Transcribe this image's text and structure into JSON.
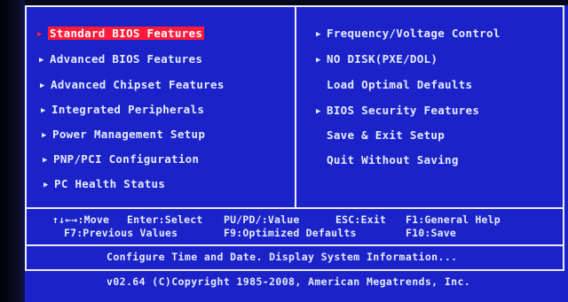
{
  "menu_left": [
    {
      "label": "Standard BIOS Features",
      "selected": true
    },
    {
      "label": "Advanced BIOS Features"
    },
    {
      "label": "Advanced Chipset Features"
    },
    {
      "label": "Integrated Peripherals"
    },
    {
      "label": "Power Management Setup"
    },
    {
      "label": "PNP/PCI Configuration"
    },
    {
      "label": "PC Health Status"
    }
  ],
  "menu_right": [
    {
      "label": "Frequency/Voltage Control",
      "arrow": true
    },
    {
      "label": "NO DISK(PXE/DOL)",
      "arrow": true
    },
    {
      "label": "Load Optimal Defaults",
      "arrow": false
    },
    {
      "label": "BIOS Security Features",
      "arrow": true
    },
    {
      "label": "Save & Exit Setup",
      "arrow": false
    },
    {
      "label": "Quit Without Saving",
      "arrow": false
    }
  ],
  "nav_row1": {
    "move": "↑↓←→:Move",
    "select": "Enter:Select",
    "value": "PU/PD/:Value",
    "exit": "ESC:Exit",
    "help": "F1:General Help"
  },
  "nav_row2": {
    "prev": "F7:Previous Values",
    "optimized": "F9:Optimized Defaults",
    "save": "F10:Save"
  },
  "status_line": "Configure Time and Date.  Display System Information...",
  "copyright": "v02.64 (C)Copyright 1985-2008, American Megatrends, Inc.",
  "icons": {
    "submenu": "triangle-right-icon"
  },
  "colors": {
    "background": "#1a22c8",
    "text": "#e6ecff",
    "highlight": "#ff1a3a",
    "border": "#e9ecff"
  }
}
